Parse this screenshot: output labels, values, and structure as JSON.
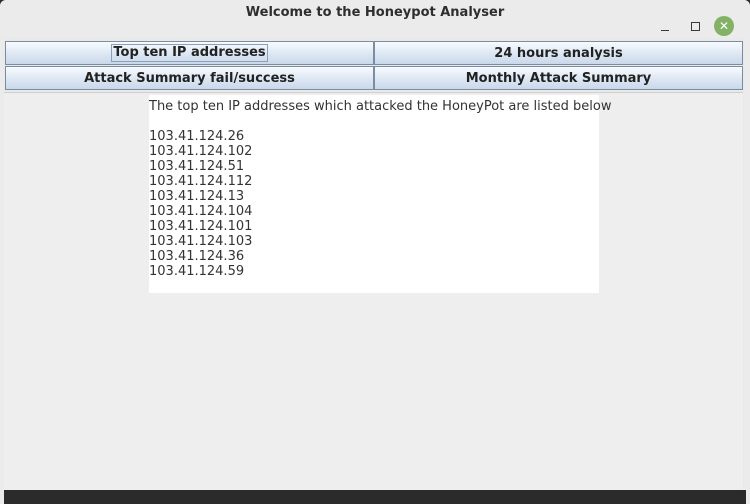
{
  "window": {
    "title": "Welcome to the Honeypot Analyser",
    "controls": {
      "minimize_icon": "minimize-icon",
      "maximize_icon": "maximize-icon",
      "close_icon": "close-icon",
      "close_color": "#83b266"
    }
  },
  "toolbar": {
    "buttons": [
      {
        "label": "Top ten IP addresses",
        "focused": true
      },
      {
        "label": "24 hours analysis"
      },
      {
        "label": "Attack Summary fail/success"
      },
      {
        "label": "Monthly Attack Summary"
      }
    ]
  },
  "panel": {
    "heading": "The top ten IP addresses which attacked the HoneyPot are listed below",
    "ips": [
      "103.41.124.26",
      "103.41.124.102",
      "103.41.124.51",
      "103.41.124.112",
      "103.41.124.13",
      "103.41.124.104",
      "103.41.124.101",
      "103.41.124.103",
      "103.41.124.36",
      "103.41.124.59"
    ]
  }
}
